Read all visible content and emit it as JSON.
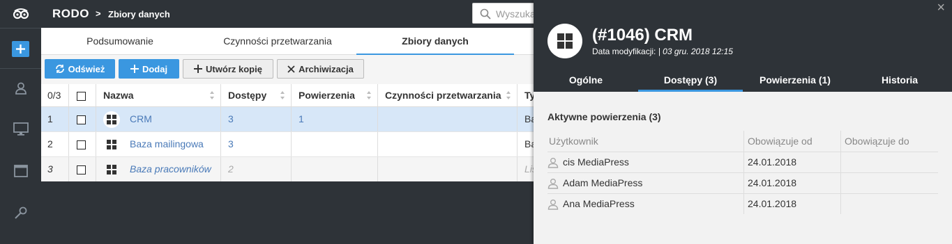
{
  "topbar": {
    "app_title": "RODO",
    "breadcrumb_sep": ">",
    "breadcrumb": "Zbiory danych",
    "search_placeholder": "Wyszukaj"
  },
  "tabs": [
    "Podsumowanie",
    "Czynności przetwarzania",
    "Zbiory danych"
  ],
  "toolbar": {
    "refresh": "Odśwież",
    "add": "Dodaj",
    "copy": "Utwórz kopię",
    "archive": "Archiwizacja"
  },
  "grid": {
    "count": "0/3",
    "headers": {
      "name": "Nazwa",
      "access": "Dostępy",
      "entrust": "Powierzenia",
      "activities": "Czynności przetwarzania",
      "type": "Ty"
    },
    "rows": [
      {
        "num": "1",
        "name": "CRM",
        "access": "3",
        "entrust": "1",
        "type": "Ba"
      },
      {
        "num": "2",
        "name": "Baza mailingowa",
        "access": "3",
        "entrust": "",
        "type": "Ba"
      },
      {
        "num": "3",
        "name": "Baza pracowników",
        "access": "2",
        "entrust": "",
        "type": "Lis"
      }
    ]
  },
  "panel": {
    "close": "×",
    "title": "(#1046) CRM",
    "modified_label": "Data modyfikacji:",
    "modified_value": "| 03 gru. 2018 12:15",
    "tabs": [
      "Ogólne",
      "Dostępy (3)",
      "Powierzenia (1)",
      "Historia"
    ],
    "section_title": "Aktywne powierzenia  (3)",
    "columns": [
      "Użytkownik",
      "Obowiązuje od",
      "Obowiązuje do"
    ],
    "rows": [
      {
        "user": "cis MediaPress",
        "from": "24.01.2018",
        "to": ""
      },
      {
        "user": "Adam MediaPress",
        "from": "24.01.2018",
        "to": ""
      },
      {
        "user": "Ana MediaPress",
        "from": "24.01.2018",
        "to": ""
      }
    ]
  },
  "colors": {
    "accent": "#3a97e0",
    "dark": "#2e3338",
    "selected_row": "#d7e7f8",
    "link": "#4a7ab8"
  }
}
